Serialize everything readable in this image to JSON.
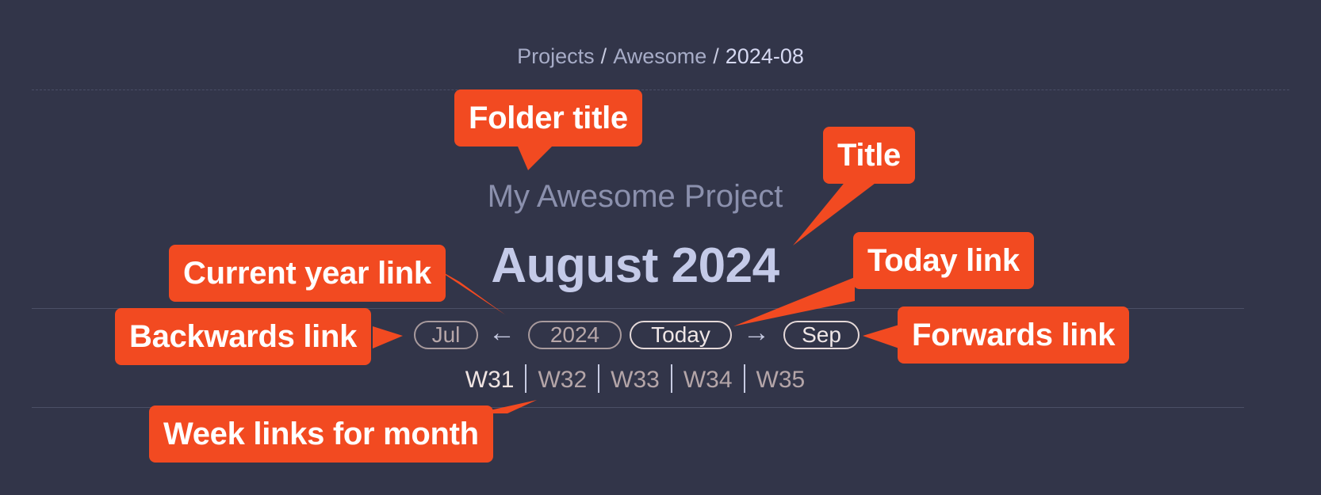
{
  "breadcrumb": {
    "items": [
      "Projects",
      "Awesome"
    ],
    "separator": "/",
    "current": "2024-08"
  },
  "folder_title": "My Awesome Project",
  "title": "August 2024",
  "nav": {
    "backwards": "Jul",
    "back_arrow": "←",
    "year": "2024",
    "today": "Today",
    "forward_arrow": "→",
    "forwards": "Sep"
  },
  "weeks": [
    "W31",
    "W32",
    "W33",
    "W34",
    "W35"
  ],
  "callouts": {
    "folder_title": "Folder title",
    "title": "Title",
    "current_year": "Current year link",
    "today": "Today link",
    "backwards": "Backwards link",
    "forwards": "Forwards link",
    "weeks": "Week links for month"
  },
  "colors": {
    "background": "#323549",
    "callout": "#f24a21",
    "title": "#c4cae8",
    "folder_title": "#8b90ad"
  }
}
